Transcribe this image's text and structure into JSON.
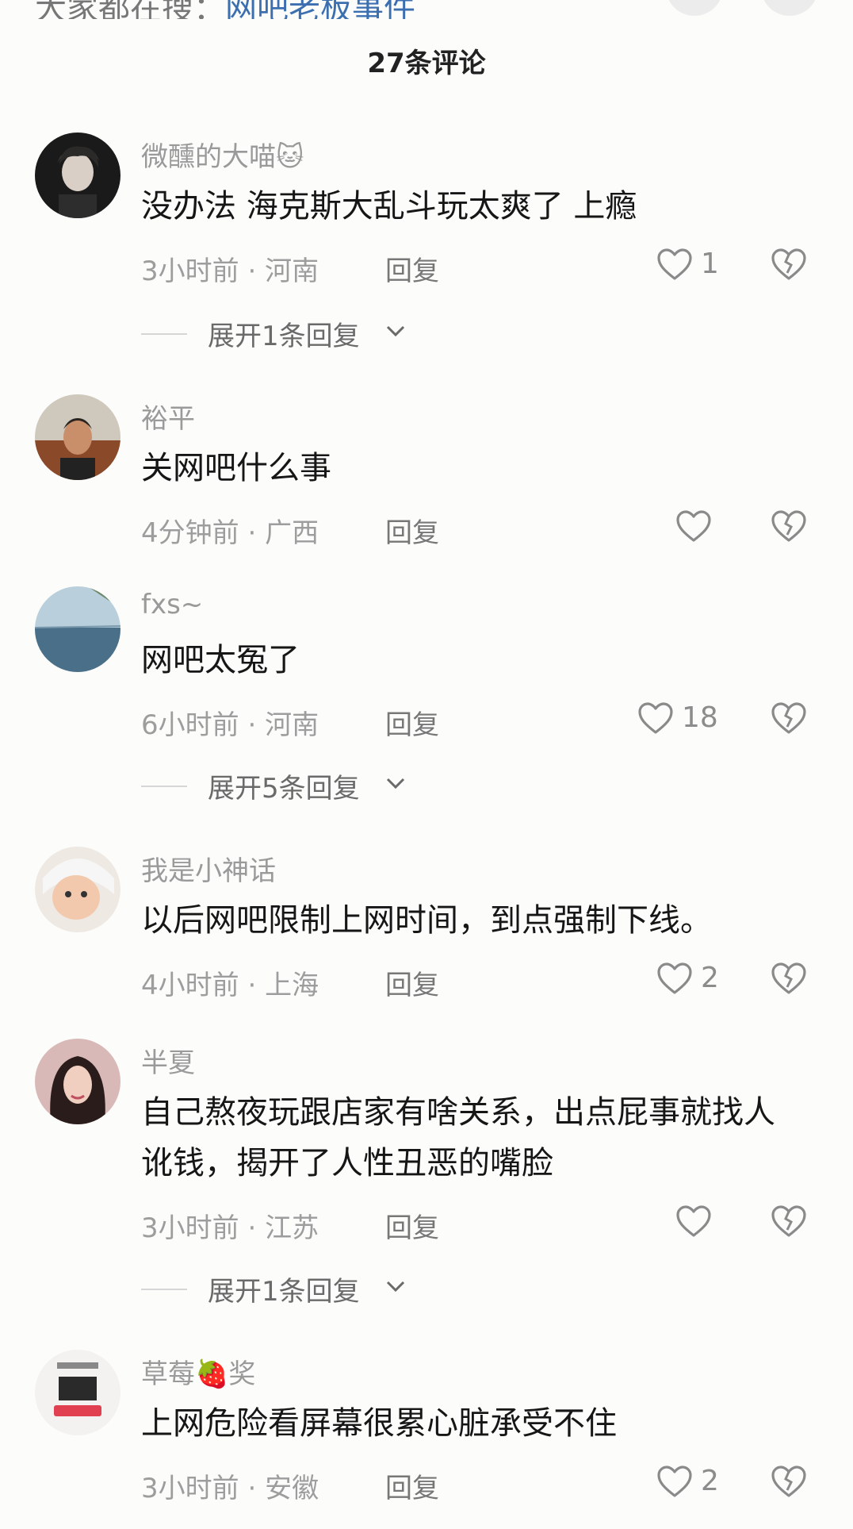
{
  "top": {
    "prefix": "大家都在搜：",
    "link": "网吧老板事件"
  },
  "comment_count": "27条评论",
  "comments": [
    {
      "name": "微醺的大喵",
      "name_emoji": "🐱",
      "text": "没办法  海克斯大乱斗玩太爽了 上瘾",
      "time": "3小时前",
      "location": "河南",
      "reply": "回复",
      "likes": "1",
      "expand": "展开1条回复"
    },
    {
      "name": "裕平",
      "name_emoji": "",
      "text": "关网吧什么事",
      "time": "4分钟前",
      "location": "广西",
      "reply": "回复",
      "likes": "",
      "expand": ""
    },
    {
      "name": "fxs~",
      "name_emoji": "",
      "text": "网吧太冤了",
      "time": "6小时前",
      "location": "河南",
      "reply": "回复",
      "likes": "18",
      "expand": "展开5条回复"
    },
    {
      "name": "我是小神话",
      "name_emoji": "",
      "text": "以后网吧限制上网时间，到点强制下线。",
      "time": "4小时前",
      "location": "上海",
      "reply": "回复",
      "likes": "2",
      "expand": ""
    },
    {
      "name": "半夏",
      "name_emoji": "",
      "text": "自己熬夜玩跟店家有啥关系，出点屁事就找人讹钱，揭开了人性丑恶的嘴脸",
      "time": "3小时前",
      "location": "江苏",
      "reply": "回复",
      "likes": "",
      "expand": "展开1条回复"
    },
    {
      "name": "草莓",
      "name_emoji": "🍓",
      "name_suffix": "奖",
      "text": "上网危险看屏幕很累心脏承受不住",
      "time": "3小时前",
      "location": "安徽",
      "reply": "回复",
      "likes": "2",
      "expand": ""
    }
  ],
  "meta_sep": " · ",
  "icons": {
    "like": "heart-outline-icon",
    "dislike": "broken-heart-icon",
    "expand": "chevron-down-icon"
  }
}
